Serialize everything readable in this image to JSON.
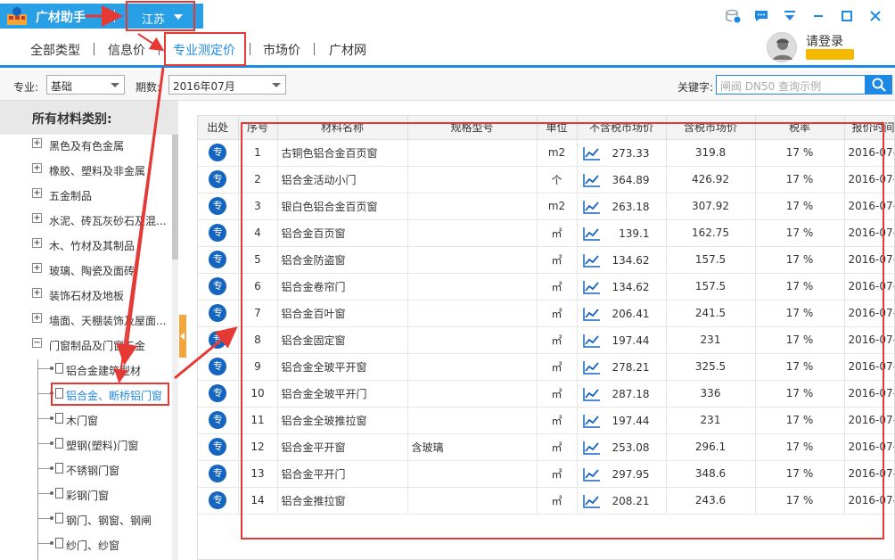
{
  "app": {
    "title": "广材助手",
    "region": "江苏"
  },
  "nav": {
    "tabs": [
      {
        "label": "全部类型"
      },
      {
        "label": "信息价"
      },
      {
        "label": "专业测定价"
      },
      {
        "label": "市场价"
      },
      {
        "label": "广材网"
      }
    ],
    "active_index": 2,
    "login_label": "请登录"
  },
  "filters": {
    "major_label": "专业:",
    "major_value": "基础",
    "period_label": "期数:",
    "period_value": "2016年07月",
    "keyword_label": "关键字:",
    "keyword_placeholder": "闸阀 DN50 查询示例"
  },
  "sidebar": {
    "title": "所有材料类别:",
    "categories": [
      {
        "label": "黑色及有色金属",
        "expanded": false
      },
      {
        "label": "橡胶、塑料及非金属",
        "expanded": false
      },
      {
        "label": "五金制品",
        "expanded": false
      },
      {
        "label": "水泥、砖瓦灰砂石及混...",
        "expanded": false
      },
      {
        "label": "木、竹材及其制品",
        "expanded": false
      },
      {
        "label": "玻璃、陶瓷及面砖",
        "expanded": false
      },
      {
        "label": "装饰石材及地板",
        "expanded": false
      },
      {
        "label": "墙面、天棚装饰及屋面...",
        "expanded": false
      },
      {
        "label": "门窗制品及门窗五金",
        "expanded": true
      }
    ],
    "children": [
      {
        "label": "铝合金建筑型材"
      },
      {
        "label": "铝合金、断桥铝门窗"
      },
      {
        "label": "木门窗"
      },
      {
        "label": "塑钢(塑料)门窗"
      },
      {
        "label": "不锈钢门窗"
      },
      {
        "label": "彩钢门窗"
      },
      {
        "label": "钢门、钢窗、钢闸"
      },
      {
        "label": "纱门、纱窗"
      }
    ],
    "selected_child_index": 1
  },
  "table": {
    "headers": [
      "出处",
      "序号",
      "材料名称",
      "规格型号",
      "单位",
      "不含税市场价",
      "含税市场价",
      "税率",
      "报价时间"
    ],
    "source_badge": "专",
    "rows": [
      {
        "no": "1",
        "name": "古铜色铝合金百页窗",
        "spec": "",
        "unit": "m2",
        "price": "273.33",
        "price_tax": "319.8",
        "rate": "17 %",
        "date": "2016-07-"
      },
      {
        "no": "2",
        "name": "铝合金活动小门",
        "spec": "",
        "unit": "个",
        "price": "364.89",
        "price_tax": "426.92",
        "rate": "17 %",
        "date": "2016-07-"
      },
      {
        "no": "3",
        "name": "银白色铝合金百页窗",
        "spec": "",
        "unit": "m2",
        "price": "263.18",
        "price_tax": "307.92",
        "rate": "17 %",
        "date": "2016-07-"
      },
      {
        "no": "4",
        "name": "铝合金百页窗",
        "spec": "",
        "unit": "㎡",
        "price": "139.1",
        "price_tax": "162.75",
        "rate": "17 %",
        "date": "2016-07-"
      },
      {
        "no": "5",
        "name": "铝合金防盗窗",
        "spec": "",
        "unit": "㎡",
        "price": "134.62",
        "price_tax": "157.5",
        "rate": "17 %",
        "date": "2016-07-"
      },
      {
        "no": "6",
        "name": "铝合金卷帘门",
        "spec": "",
        "unit": "㎡",
        "price": "134.62",
        "price_tax": "157.5",
        "rate": "17 %",
        "date": "2016-07-"
      },
      {
        "no": "7",
        "name": "铝合金百叶窗",
        "spec": "",
        "unit": "㎡",
        "price": "206.41",
        "price_tax": "241.5",
        "rate": "17 %",
        "date": "2016-07-"
      },
      {
        "no": "8",
        "name": "铝合金固定窗",
        "spec": "",
        "unit": "㎡",
        "price": "197.44",
        "price_tax": "231",
        "rate": "17 %",
        "date": "2016-07-"
      },
      {
        "no": "9",
        "name": "铝合金全玻平开窗",
        "spec": "",
        "unit": "㎡",
        "price": "278.21",
        "price_tax": "325.5",
        "rate": "17 %",
        "date": "2016-07-"
      },
      {
        "no": "10",
        "name": "铝合金全玻平开门",
        "spec": "",
        "unit": "㎡",
        "price": "287.18",
        "price_tax": "336",
        "rate": "17 %",
        "date": "2016-07-"
      },
      {
        "no": "11",
        "name": "铝合金全玻推拉窗",
        "spec": "",
        "unit": "㎡",
        "price": "197.44",
        "price_tax": "231",
        "rate": "17 %",
        "date": "2016-07-"
      },
      {
        "no": "12",
        "name": "铝合金平开窗",
        "spec": "含玻璃",
        "unit": "㎡",
        "price": "253.08",
        "price_tax": "296.1",
        "rate": "17 %",
        "date": "2016-07-"
      },
      {
        "no": "13",
        "name": "铝合金平开门",
        "spec": "",
        "unit": "㎡",
        "price": "297.95",
        "price_tax": "348.6",
        "rate": "17 %",
        "date": "2016-07-"
      },
      {
        "no": "14",
        "name": "铝合金推拉窗",
        "spec": "",
        "unit": "㎡",
        "price": "208.21",
        "price_tax": "243.6",
        "rate": "17 %",
        "date": "2016-07-"
      }
    ]
  },
  "colors": {
    "accent": "#1e88e5",
    "annotation": "#e53935",
    "badge": "#1565c0",
    "brand": "#29a0e6"
  }
}
